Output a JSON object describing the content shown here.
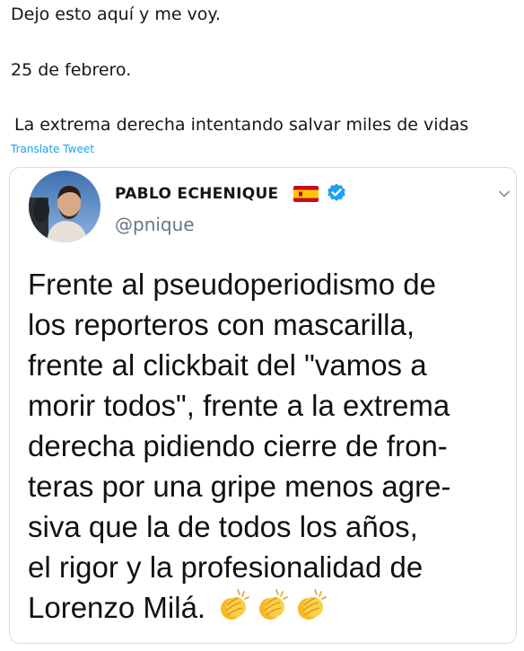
{
  "tweet": {
    "lines": [
      "Dejo esto aquí y me voy.",
      "25 de febrero.",
      "La extrema derecha intentando salvar miles de vidas"
    ],
    "translate_label": "Translate Tweet"
  },
  "quoted_tweet": {
    "display_name": "PABLO ECHENIQUE",
    "handle": "@pnique",
    "flag_icon": "spain-flag-icon",
    "verified_icon": "verified-badge-icon",
    "menu_icon": "chevron-down-icon",
    "text_lines": [
      "Frente al pseudoperiodismo de",
      "los reporteros con mascarilla,",
      "frente al clickbait del \"vamos a",
      "morir todos\", frente a la extrema",
      "derecha pidiendo cierre de fron-",
      "teras por una gripe menos agre-",
      "siva que la de todos los años,",
      "el rigor y la profesionalidad de",
      "Lorenzo Milá."
    ],
    "trailing_icons": [
      "clapping-hands-icon",
      "clapping-hands-icon",
      "clapping-hands-icon"
    ]
  },
  "colors": {
    "link": "#1da1f2",
    "secondary_text": "#657786",
    "border": "#d6dce2",
    "verified": "#1da1f2"
  }
}
